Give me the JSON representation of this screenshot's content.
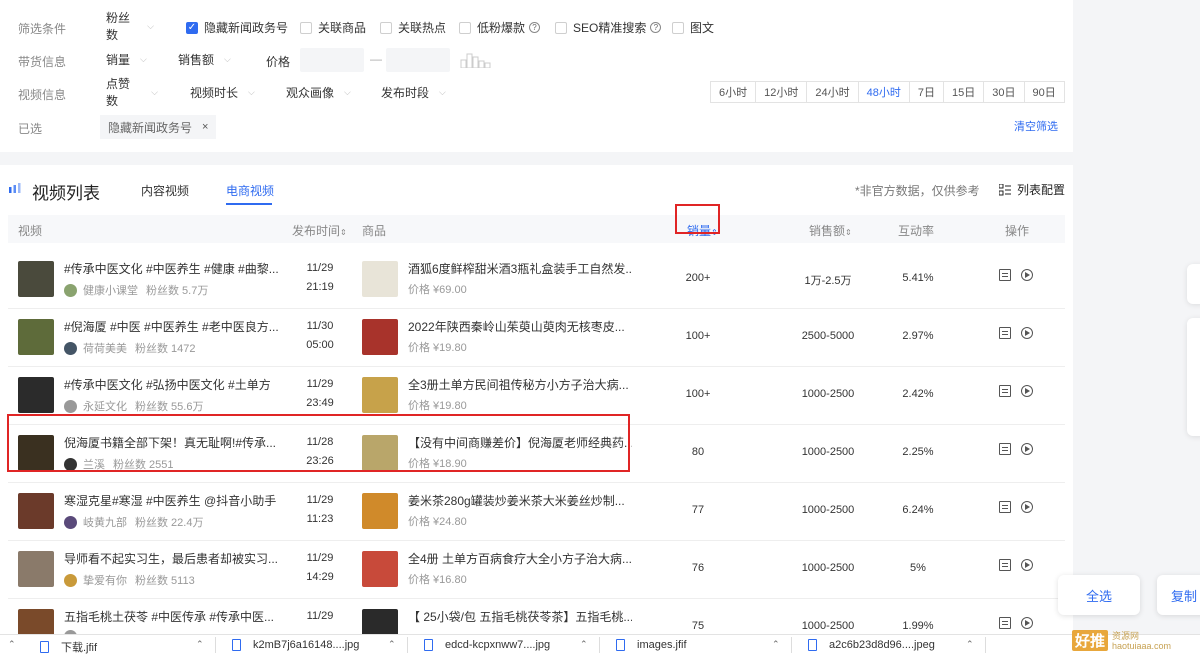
{
  "filters": {
    "row1_label": "筛选条件",
    "fans_select": "粉丝数",
    "checkboxes": [
      {
        "label": "隐藏新闻政务号",
        "checked": true
      },
      {
        "label": "关联商品",
        "checked": false
      },
      {
        "label": "关联热点",
        "checked": false
      },
      {
        "label": "低粉爆款",
        "checked": false
      },
      {
        "label": "SEO精准搜索",
        "checked": false
      },
      {
        "label": "图文",
        "checked": false
      }
    ],
    "row2_label": "带货信息",
    "sales_select": "销量",
    "amount_select": "销售额",
    "price_label": "价格",
    "price_sep": "—",
    "row3_label": "视频信息",
    "likes_select": "点赞数",
    "duration_select": "视频时长",
    "audience_select": "观众画像",
    "publish_select": "发布时段",
    "time_ranges": [
      "6小时",
      "12小时",
      "24小时",
      "48小时",
      "7日",
      "15日",
      "30日",
      "90日"
    ],
    "time_selected": "48小时",
    "row4_label": "已选",
    "selected_tag": "隐藏新闻政务号",
    "tag_close": "×",
    "clear_label": "清空筛选"
  },
  "list": {
    "title": "视频列表",
    "tabs": [
      "内容视频",
      "电商视频"
    ],
    "active_tab": "电商视频",
    "note": "*非官方数据，仅供参考",
    "config_label": "列表配置",
    "headers": {
      "video": "视频",
      "publish_time": "发布时间",
      "product": "商品",
      "sales": "销量",
      "amount": "销售额",
      "rate": "互动率",
      "ops": "操作"
    },
    "rows": [
      {
        "title": "#传承中医文化 #中医养生 #健康 #曲黎...",
        "author": "健康小课堂",
        "fans": "粉丝数 5.7万",
        "date": "11/29",
        "time": "21:19",
        "product": "酒狐6度鲜榨甜米酒3瓶礼盒装手工自然发...",
        "price": "价格 ¥69.00",
        "sales": "200+",
        "amount": "1万-2.5万",
        "rate": "5.41%",
        "thumb": "#4a4a3c",
        "pimg": "#e8e4d8",
        "av": "#8aa36f"
      },
      {
        "title": "#倪海厦 #中医 #中医养生 #老中医良方...",
        "author": "荷荷美美",
        "fans": "粉丝数 1472",
        "date": "11/30",
        "time": "05:00",
        "product": "2022年陕西秦岭山茱萸山萸肉无核枣皮...",
        "price": "价格 ¥19.80",
        "sales": "100+",
        "amount": "2500-5000",
        "rate": "2.97%",
        "thumb": "#5e6b3a",
        "pimg": "#a8332b",
        "av": "#445566"
      },
      {
        "title": "#传承中医文化 #弘扬中医文化 #土单方",
        "author": "永延文化",
        "fans": "粉丝数 55.6万",
        "date": "11/29",
        "time": "23:49",
        "product": "全3册土单方民间祖传秘方小方子治大病...",
        "price": "价格 ¥19.80",
        "sales": "100+",
        "amount": "1000-2500",
        "rate": "2.42%",
        "thumb": "#2b2b2b",
        "pimg": "#c7a24a",
        "av": "#999999"
      },
      {
        "title": "倪海厦书籍全部下架！真无耻啊!#传承...",
        "author": "兰溪",
        "fans": "粉丝数 2551",
        "date": "11/28",
        "time": "23:26",
        "product": "【没有中间商赚差价】倪海厦老师经典药...",
        "price": "价格 ¥18.90",
        "sales": "80",
        "amount": "1000-2500",
        "rate": "2.25%",
        "thumb": "#3a3020",
        "pimg": "#b9a66a",
        "av": "#333333"
      },
      {
        "title": "寒湿克星#寒湿 #中医养生 @抖音小助手",
        "author": "岐黄九部",
        "fans": "粉丝数 22.4万",
        "date": "11/29",
        "time": "11:23",
        "product": "姜米茶280g罐装炒姜米茶大米姜丝炒制...",
        "price": "价格 ¥24.80",
        "sales": "77",
        "amount": "1000-2500",
        "rate": "6.24%",
        "thumb": "#6b3a2a",
        "pimg": "#d08a2a",
        "av": "#5a4a7a"
      },
      {
        "title": "导师看不起实习生，最后患者却被实习...",
        "author": "挚爱有你",
        "fans": "粉丝数 5113",
        "date": "11/29",
        "time": "14:29",
        "product": "全4册 土单方百病食疗大全小方子治大病...",
        "price": "价格 ¥16.80",
        "sales": "76",
        "amount": "1000-2500",
        "rate": "5%",
        "thumb": "#8a7a6a",
        "pimg": "#c84a3a",
        "av": "#c99a3a"
      },
      {
        "title": "五指毛桃土茯苓 #中医传承 #传承中医...",
        "author": "",
        "fans": "",
        "date": "11/29",
        "time": "",
        "product": "【 25小袋/包 五指毛桃茯苓茶】五指毛桃...",
        "price": "",
        "sales": "75",
        "amount": "1000-2500",
        "rate": "1.99%",
        "thumb": "#7a4a2a",
        "pimg": "#2a2a2a",
        "av": "#999999"
      }
    ]
  },
  "downloads": [
    {
      "name": "下载.jfif"
    },
    {
      "name": "k2mB7j6a16148....jpg"
    },
    {
      "name": "edcd-kcpxnww7....jpg"
    },
    {
      "name": "images.jfif"
    },
    {
      "name": "a2c6b23d8d96....jpeg"
    }
  ],
  "float_buttons": {
    "select_all": "全选",
    "copy": "复制"
  },
  "watermark": {
    "big": "好推",
    "small1": "资源网",
    "small2": "haotuiaaa.com"
  },
  "colors": {
    "accent": "#2f6bf0",
    "highlight": "#e02525"
  }
}
